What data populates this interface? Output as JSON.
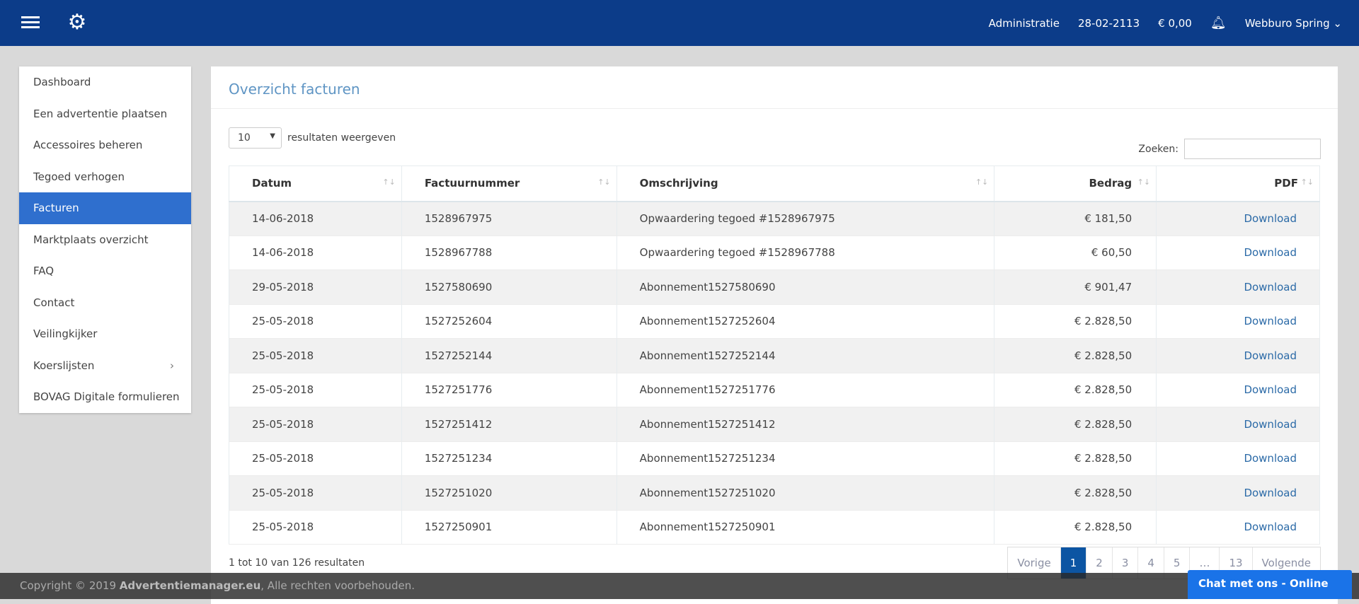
{
  "header": {
    "admin": "Administratie",
    "date": "28-02-2113",
    "balance": "€ 0,00",
    "user": "Webburo Spring"
  },
  "sidebar": {
    "items": [
      {
        "label": "Dashboard"
      },
      {
        "label": "Een advertentie plaatsen"
      },
      {
        "label": "Accessoires beheren"
      },
      {
        "label": "Tegoed verhogen"
      },
      {
        "label": "Facturen"
      },
      {
        "label": "Marktplaats overzicht"
      },
      {
        "label": "FAQ"
      },
      {
        "label": "Contact"
      },
      {
        "label": "Veilingkijker"
      },
      {
        "label": "Koerslijsten"
      },
      {
        "label": "BOVAG Digitale formulieren"
      }
    ],
    "active": "Facturen"
  },
  "main": {
    "title": "Overzicht facturen",
    "length_value": "10",
    "length_label": "resultaten weergeven",
    "search_label": "Zoeken:",
    "search_value": "",
    "columns": [
      "Datum",
      "Factuurnummer",
      "Omschrijving",
      "Bedrag",
      "PDF"
    ],
    "rows": [
      [
        "14-06-2018",
        "1528967975",
        "Opwaardering tegoed #1528967975",
        "€ 181,50",
        "Download"
      ],
      [
        "14-06-2018",
        "1528967788",
        "Opwaardering tegoed #1528967788",
        "€ 60,50",
        "Download"
      ],
      [
        "29-05-2018",
        "1527580690",
        "Abonnement1527580690",
        "€ 901,47",
        "Download"
      ],
      [
        "25-05-2018",
        "1527252604",
        "Abonnement1527252604",
        "€ 2.828,50",
        "Download"
      ],
      [
        "25-05-2018",
        "1527252144",
        "Abonnement1527252144",
        "€ 2.828,50",
        "Download"
      ],
      [
        "25-05-2018",
        "1527251776",
        "Abonnement1527251776",
        "€ 2.828,50",
        "Download"
      ],
      [
        "25-05-2018",
        "1527251412",
        "Abonnement1527251412",
        "€ 2.828,50",
        "Download"
      ],
      [
        "25-05-2018",
        "1527251234",
        "Abonnement1527251234",
        "€ 2.828,50",
        "Download"
      ],
      [
        "25-05-2018",
        "1527251020",
        "Abonnement1527251020",
        "€ 2.828,50",
        "Download"
      ],
      [
        "25-05-2018",
        "1527250901",
        "Abonnement1527250901",
        "€ 2.828,50",
        "Download"
      ]
    ],
    "info": "1 tot 10 van 126 resultaten",
    "pagination": [
      "Vorige",
      "1",
      "2",
      "3",
      "4",
      "5",
      "…",
      "13",
      "Volgende"
    ],
    "current_page": "1"
  },
  "footer": {
    "prefix": "Copyright © 2019 ",
    "brand": "Advertentiemanager.eu",
    "suffix": ", Alle rechten voorbehouden."
  },
  "chat": "Chat met ons - Online"
}
